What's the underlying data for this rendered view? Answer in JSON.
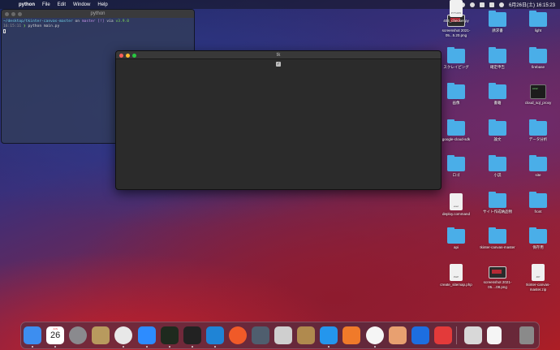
{
  "menubar": {
    "app_name": "python",
    "menus": [
      "File",
      "Edit",
      "Window",
      "Help"
    ],
    "clock": "6月26日(土) 16:15:23"
  },
  "terminal": {
    "title": "python",
    "prompt_path": "~/desktop/tkinter-canvas-master",
    "prompt_on": "on",
    "branch": "master",
    "branch_status": "[!]",
    "via": "via",
    "python_version": "v3.9.0",
    "time": "16:15:11",
    "command": "python main.py"
  },
  "tk_window": {
    "title": "tk"
  },
  "desktop_icons": [
    {
      "label": "screenshot 2021-05...5.20.png",
      "type": "shot"
    },
    {
      "label": "請求書",
      "type": "folder"
    },
    {
      "label": "light",
      "type": "folder"
    },
    {
      "label": "スクレイピング",
      "type": "folder"
    },
    {
      "label": "確定申告",
      "type": "folder"
    },
    {
      "label": "firebase",
      "type": "folder"
    },
    {
      "label": "画像",
      "type": "folder"
    },
    {
      "label": "書籍",
      "type": "folder"
    },
    {
      "label": "cloud_sql_proxy",
      "type": "term"
    },
    {
      "label": "google-cloud-sdk",
      "type": "folder"
    },
    {
      "label": "論文",
      "type": "folder"
    },
    {
      "label": "データ分析",
      "type": "folder"
    },
    {
      "label": "ロゴ",
      "type": "folder"
    },
    {
      "label": "小説",
      "type": "folder"
    },
    {
      "label": "site",
      "type": "folder"
    },
    {
      "label": "deploy.command",
      "type": "file",
      "file_tag": "exec"
    },
    {
      "label": "サイト作成納品物",
      "type": "folder"
    },
    {
      "label": "front",
      "type": "folder"
    },
    {
      "label": "api",
      "type": "folder"
    },
    {
      "label": "tkinter-canvas-master",
      "type": "folder"
    },
    {
      "label": "保存用",
      "type": "folder"
    },
    {
      "label": "create_sitemap.php",
      "type": "file",
      "file_tag": "PHP"
    },
    {
      "label": "screenshot 2021-05....08.png",
      "type": "shot"
    },
    {
      "label": "tkinter-canvas-master.zip",
      "type": "file",
      "file_tag": "ZIP"
    },
    {
      "label": "404_checker.py",
      "type": "file",
      "file_tag": "PYTHON"
    }
  ],
  "dock": {
    "calendar_day": "26",
    "apps": [
      {
        "name": "finder-icon",
        "color": "#3d8ef0"
      },
      {
        "name": "calendar-icon",
        "color": "#ffffff"
      },
      {
        "name": "system-preferences-icon",
        "color": "#8a8a8e"
      },
      {
        "name": "archive-icon",
        "color": "#b89a5e"
      },
      {
        "name": "chrome-icon",
        "color": "#e8e8e8"
      },
      {
        "name": "zoom-icon",
        "color": "#2d8cff"
      },
      {
        "name": "activity-monitor-icon",
        "color": "#1e2a1e"
      },
      {
        "name": "terminal-icon",
        "color": "#222222"
      },
      {
        "name": "vscode-icon",
        "color": "#1f84d6"
      },
      {
        "name": "safari-icon",
        "color": "#f05a28"
      },
      {
        "name": "quicktime-icon",
        "color": "#4f5e6e"
      },
      {
        "name": "db-icon",
        "color": "#cfcfcf"
      },
      {
        "name": "photo-app-icon",
        "color": "#b08a4e"
      },
      {
        "name": "docker-icon",
        "color": "#2496ed"
      },
      {
        "name": "network-icon",
        "color": "#f07a2a"
      },
      {
        "name": "mercury-icon",
        "color": "#f5f5f5"
      },
      {
        "name": "preview-icon",
        "color": "#e8a070"
      },
      {
        "name": "infinity-icon",
        "color": "#1d6ee0"
      },
      {
        "name": "clock-icon",
        "color": "#e33a3a"
      }
    ]
  }
}
